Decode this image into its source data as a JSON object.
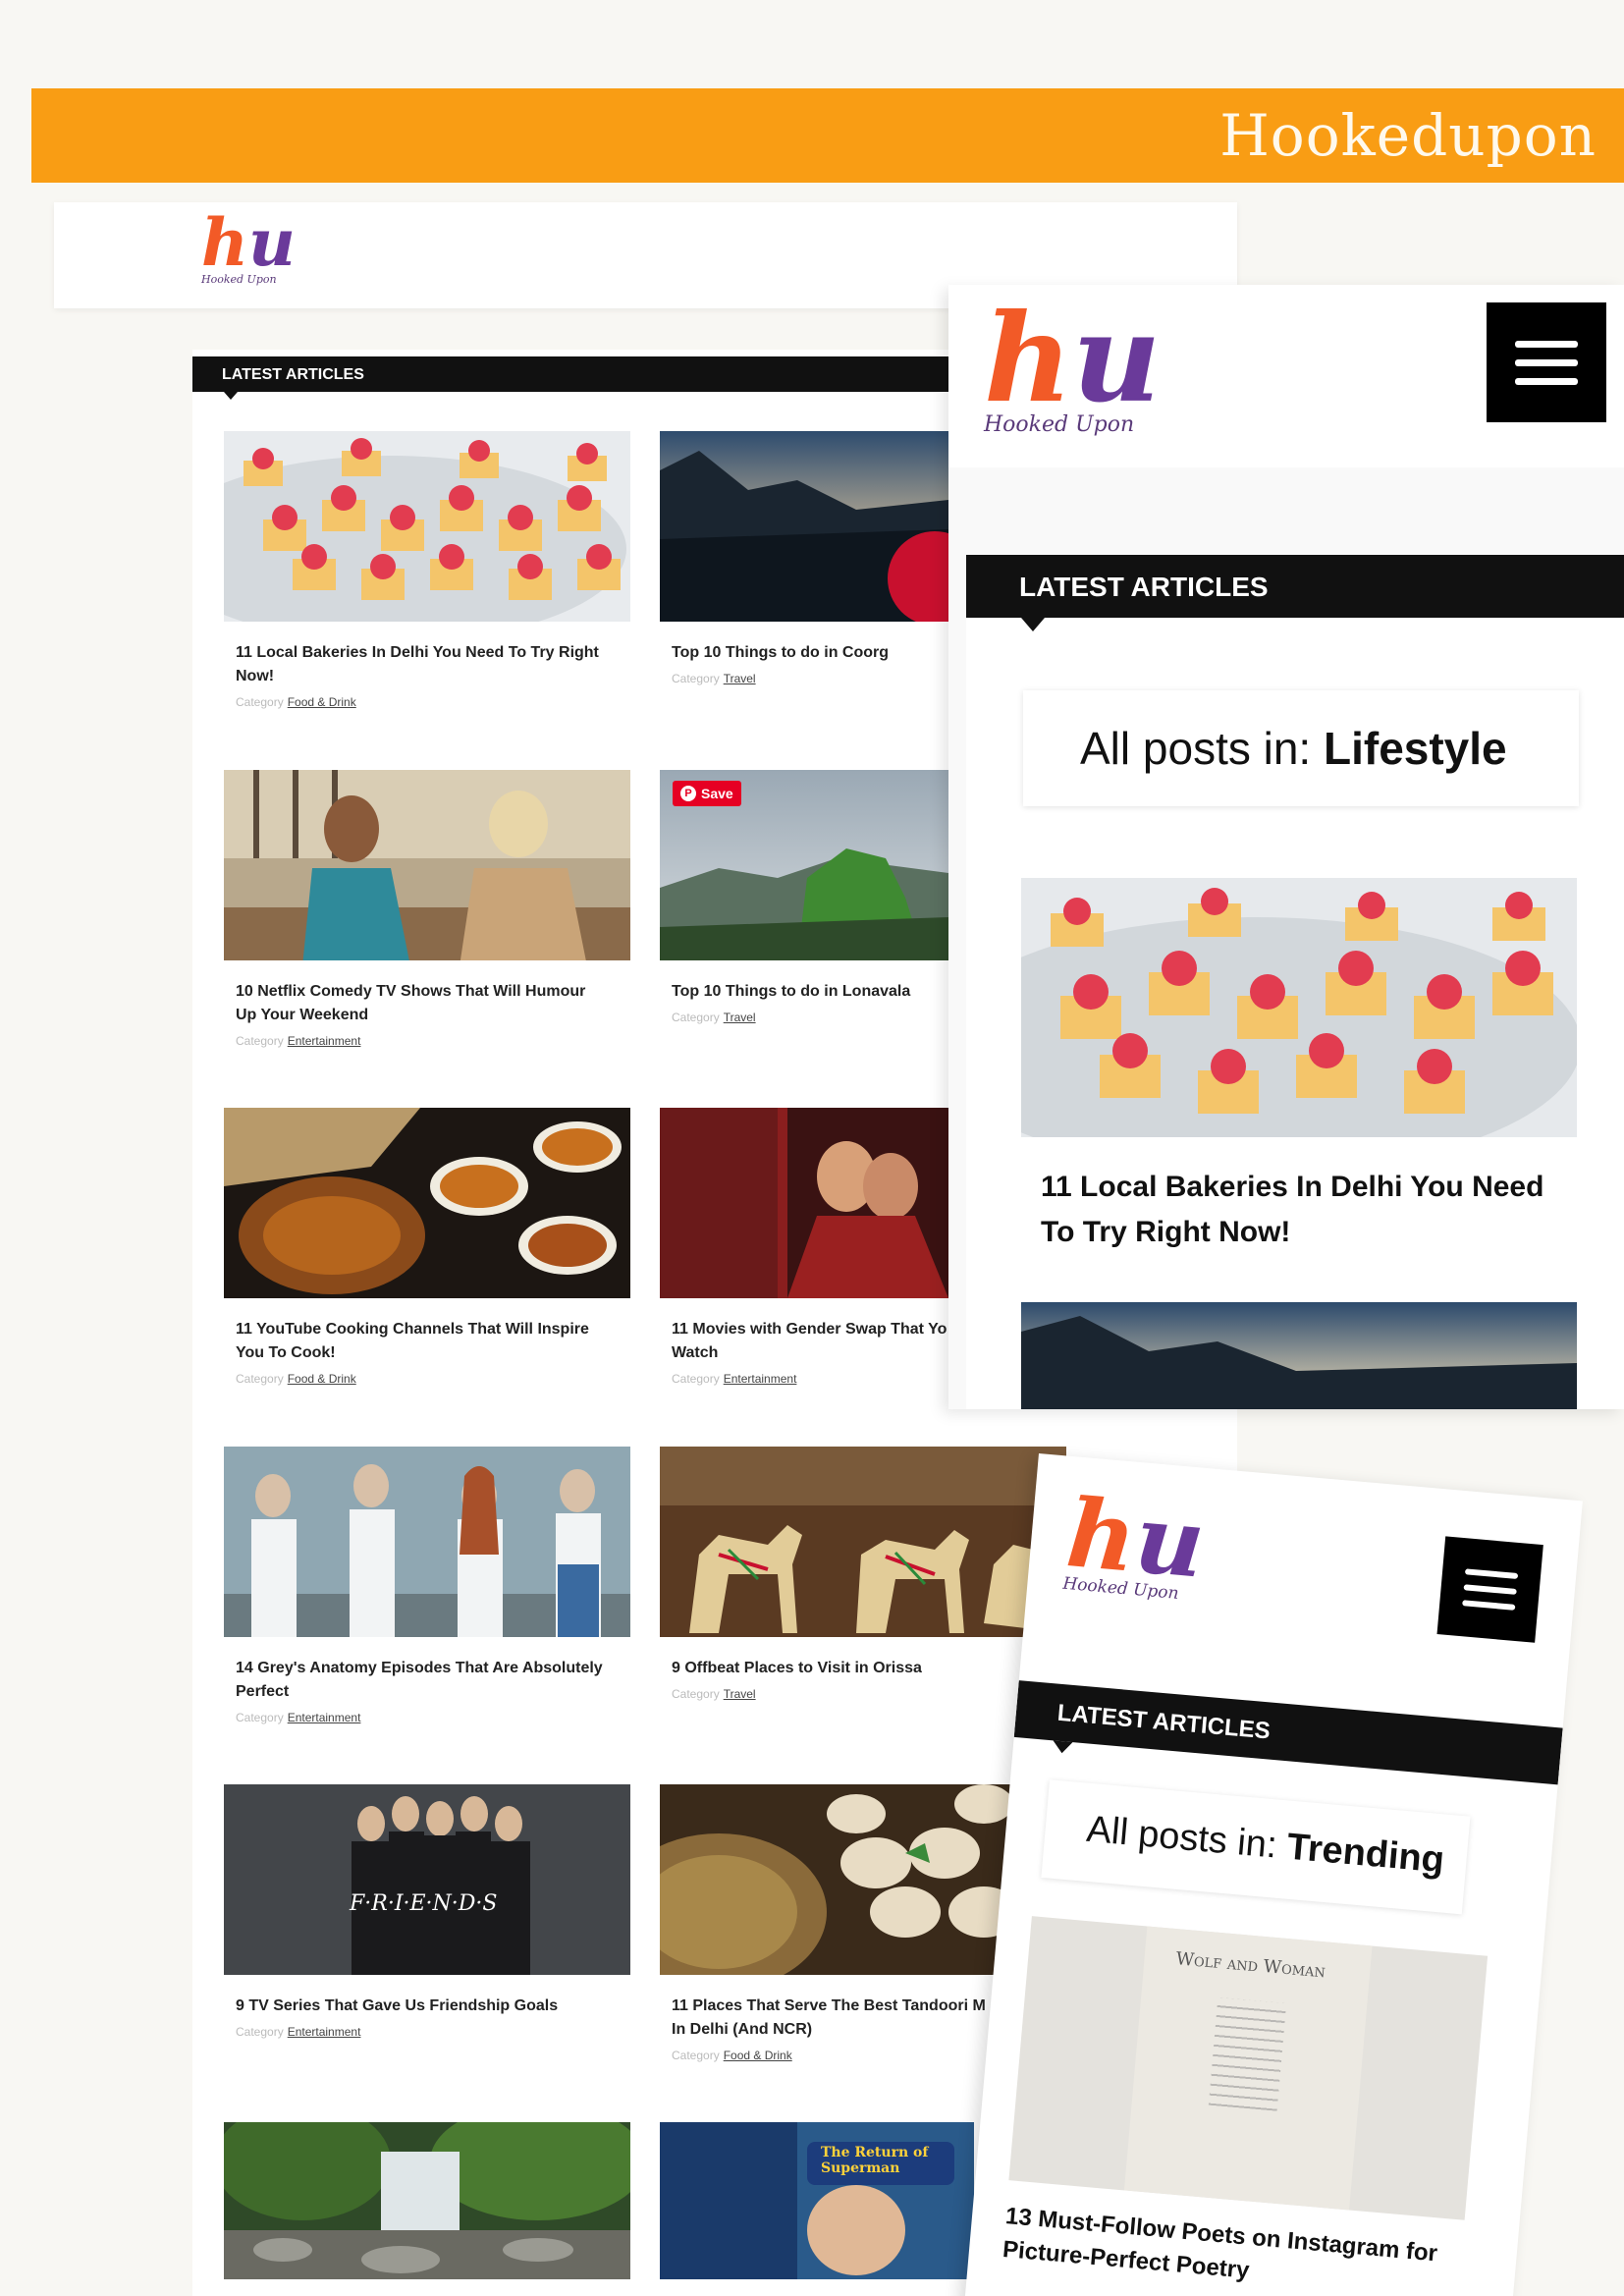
{
  "banner": {
    "title": "Hookedupon",
    "color": "#f99d14"
  },
  "logo": {
    "tagline": "Hooked Upon"
  },
  "desktop": {
    "section_label": "LATEST ARTICLES",
    "category_prefix": "Category",
    "save_label": "Save",
    "articles": [
      {
        "title": "11 Local Bakeries In Delhi You Need To Try Right\nNow!",
        "category": "Food & Drink"
      },
      {
        "title": "Top 10 Things to do in Coorg",
        "category": "Travel"
      },
      {
        "title": "10 Netflix Comedy TV Shows That Will Humour\nUp Your Weekend",
        "category": "Entertainment"
      },
      {
        "title": "Top 10 Things to do in Lonavala",
        "category": "Travel"
      },
      {
        "title": "11 YouTube Cooking Channels That Will Inspire\nYou To Cook!",
        "category": "Food & Drink"
      },
      {
        "title": "11 Movies with Gender Swap That Yo\nWatch",
        "category": "Entertainment"
      },
      {
        "title": "14 Grey's Anatomy Episodes That Are Absolutely\nPerfect",
        "category": "Entertainment"
      },
      {
        "title": "9 Offbeat Places to Visit in Orissa",
        "category": "Travel"
      },
      {
        "title": "9 TV Series That Gave Us Friendship Goals",
        "category": "Entertainment"
      },
      {
        "title": "11 Places That Serve The Best Tandoori M\nIn Delhi (And NCR)",
        "category": "Food & Drink"
      }
    ],
    "image_texts": {
      "friends": "F·R·I·E·N·D·S",
      "superman": "The Return of Superman"
    }
  },
  "phone1": {
    "section_label": "LATEST ARTICLES",
    "all_posts_prefix": "All posts in: ",
    "all_posts_category": "Lifestyle",
    "article_title": "11 Local Bakeries In Delhi You Need To Try Right Now!"
  },
  "phone2": {
    "section_label": "LATEST ARTICLES",
    "all_posts_prefix": "All posts in: ",
    "all_posts_category": "Trending",
    "image_text": "Wolf and Woman",
    "article_title": "13 Must-Follow Poets on Instagram for Picture-Perfect Poetry"
  }
}
